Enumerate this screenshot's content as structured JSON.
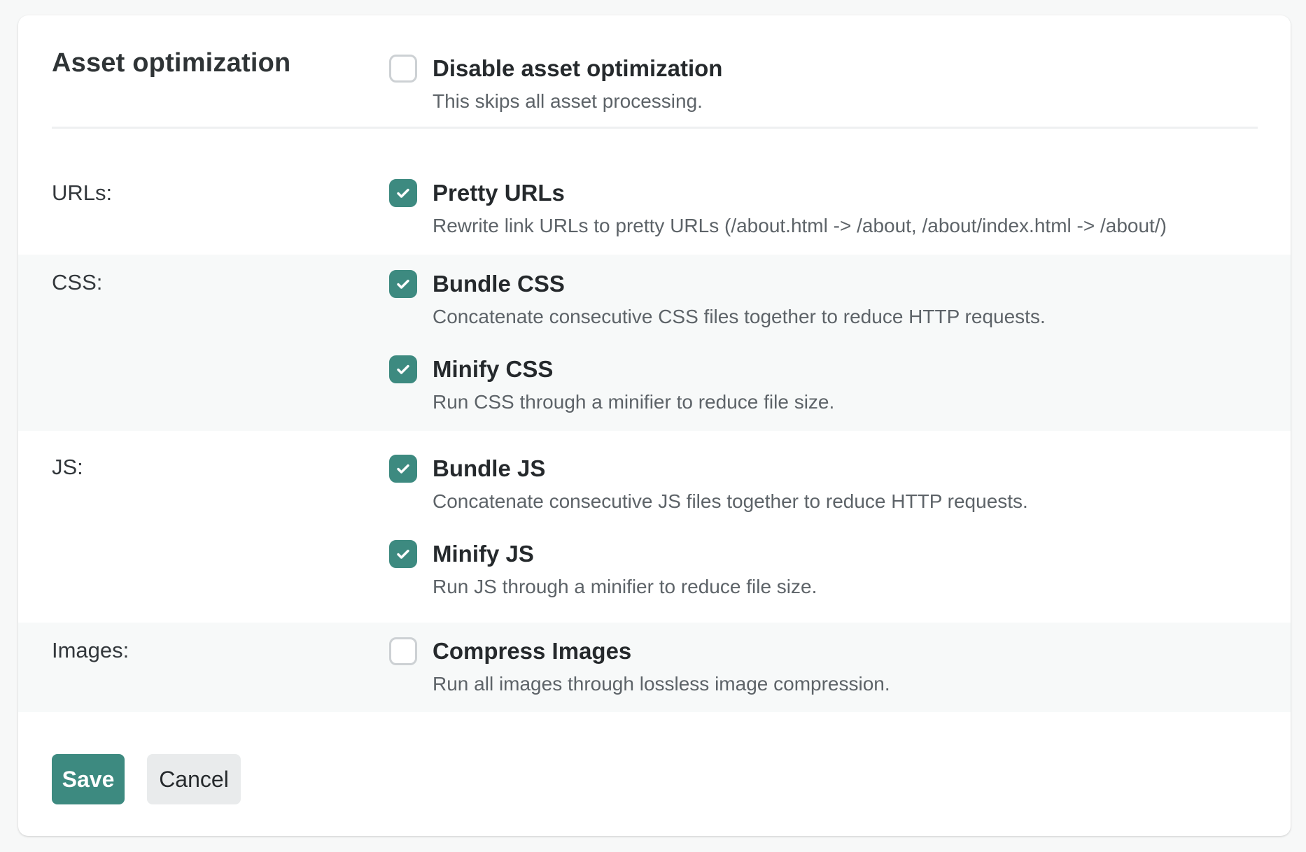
{
  "section": {
    "title": "Asset optimization"
  },
  "disable": {
    "title": "Disable asset optimization",
    "description": "This skips all asset processing.",
    "checked": false
  },
  "rows": {
    "urls": {
      "label": "URLs:"
    },
    "css": {
      "label": "CSS:"
    },
    "js": {
      "label": "JS:"
    },
    "images": {
      "label": "Images:"
    }
  },
  "options": {
    "pretty_urls": {
      "title": "Pretty URLs",
      "description": "Rewrite link URLs to pretty URLs (/about.html -> /about, /about/index.html -> /about/)",
      "checked": true
    },
    "bundle_css": {
      "title": "Bundle CSS",
      "description": "Concatenate consecutive CSS files together to reduce HTTP requests.",
      "checked": true
    },
    "minify_css": {
      "title": "Minify CSS",
      "description": "Run CSS through a minifier to reduce file size.",
      "checked": true
    },
    "bundle_js": {
      "title": "Bundle JS",
      "description": "Concatenate consecutive JS files together to reduce HTTP requests.",
      "checked": true
    },
    "minify_js": {
      "title": "Minify JS",
      "description": "Run JS through a minifier to reduce file size.",
      "checked": true
    },
    "compress_images": {
      "title": "Compress Images",
      "description": "Run all images through lossless image compression.",
      "checked": false
    }
  },
  "buttons": {
    "save": "Save",
    "cancel": "Cancel"
  },
  "colors": {
    "accent": "#3d8a80",
    "alt_row": "#f7f9f9",
    "unchecked_border": "#cdd1d4"
  },
  "icons": {
    "check": "checkmark-icon"
  }
}
